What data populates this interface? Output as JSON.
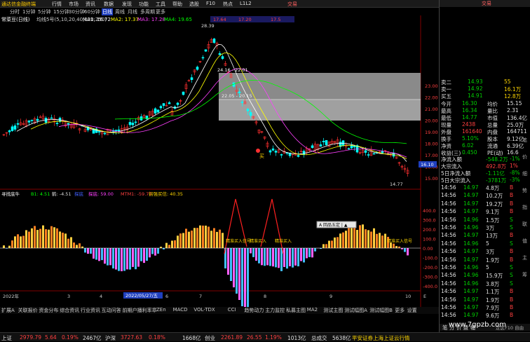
{
  "menubar": {
    "logo_text": "通达信金融终端",
    "items": [
      "行情",
      "市场",
      "资讯",
      "数据",
      "发现",
      "功能",
      "工具",
      "帮助",
      "选股",
      "F10",
      "热点",
      "L1L2",
      "交易"
    ]
  },
  "periods": [
    "分时",
    "1分钟",
    "5分钟",
    "15分钟",
    "30分钟",
    "60分钟",
    "日线",
    "周线",
    "月线",
    "多周期",
    "更多"
  ],
  "active_period": "日线",
  "main_chart": {
    "title": "常菜豆(日线)",
    "ma_label": "均线5号(5,10,20,40,120,250)",
    "ma1": "MA1: 16.72",
    "ma2": "MA2: 17.37",
    "ma3": "MA3: 17.28",
    "ma4": "MA4: 19.65",
    "extra1": "17.64",
    "extra2": "17.20",
    "extra3": "17.5",
    "high_label": "28.39",
    "low_label": "14.77",
    "box_label1": "24.16 - 22.01",
    "box_label2": "22.05 - 20.15",
    "buy_label": "买",
    "price_ticks": [
      "23.00",
      "22.00",
      "21.00",
      "20.00",
      "19.00",
      "18.00",
      "17.00",
      "16.00",
      "15.00"
    ],
    "current_price": "16.10"
  },
  "indicator": {
    "name": "寻找底牛",
    "v1": "B1: 4.51",
    "v2": "鹤: -4.51",
    "v3": "探底",
    "v4": "探底: 59.00",
    "v5": "MTM1: -59.77",
    "v6": "拐强买信: 40.35",
    "ticks": [
      "400.0",
      "300.0",
      "200.0",
      "100.0",
      "0.00",
      "-100.0",
      "-200.0",
      "-300.0",
      "-400.0"
    ],
    "tooltip": "A 回品五定 | ▲",
    "signal_labels": [
      "精准买入信号",
      "精准买入",
      "精准买入",
      "精准买入信号"
    ]
  },
  "date_axis": {
    "labels": [
      "2022年",
      "3",
      "4",
      "5",
      "6",
      "7",
      "8",
      "9",
      "10",
      "E"
    ],
    "highlight": "2022/05/27/五"
  },
  "bottom_tabs": [
    "扩展A",
    "关联报价",
    "资金分布",
    "综合资讯",
    "行业资讯",
    "互动问答",
    "前期户播利率章",
    "ZEn",
    "MACD",
    "VOL-TDX",
    "CCI",
    "趋势动力",
    "主力监控",
    "私募主图",
    "MA2",
    "测试主图",
    "测试幅图A",
    "测试幅图B",
    "更多",
    "设置"
  ],
  "right_panel": {
    "ask": [
      {
        "label": "卖二",
        "price": "14.93",
        "vol": "55"
      },
      {
        "label": "卖一",
        "price": "14.92",
        "vol": "16.1万"
      },
      {
        "label": "买五",
        "price": "14.91",
        "vol": "12.8万"
      }
    ],
    "stats": [
      {
        "l1": "今开",
        "v1": "16.30",
        "l2": "均价",
        "v2": "15.15"
      },
      {
        "l1": "最高",
        "v1": "16.34",
        "l2": "量比",
        "v2": "2.31"
      },
      {
        "l1": "最低",
        "v1": "14.77",
        "l2": "市值",
        "v2": "136.4亿"
      },
      {
        "l1": "现量",
        "v1": "2438",
        "l2": "总量",
        "v2": "25.0万"
      },
      {
        "l1": "外盘",
        "v1": "161640",
        "l2": "内盘",
        "v2": "164711"
      },
      {
        "l1": "换手",
        "v1": "5.10%",
        "l2": "股本",
        "v2": "9.12亿"
      },
      {
        "l1": "净资",
        "v1": "6.02",
        "l2": "流通",
        "v2": "6.39亿"
      },
      {
        "l1": "收益(三)",
        "v1": "0.450",
        "l2": "PE(动)",
        "v2": "16.6"
      }
    ],
    "flows": [
      {
        "label": "净流入额",
        "value": "-548.2万",
        "pct": "-1%"
      },
      {
        "label": "大宗流入",
        "value": "492.8万",
        "pct": "1%"
      },
      {
        "label": "5日净流入额",
        "value": "-1.11亿",
        "pct": "-8%"
      },
      {
        "label": "5日大宗流入",
        "value": "-3781万",
        "pct": "-3%"
      }
    ],
    "ticks": [
      {
        "t": "14:56",
        "p": "14.97",
        "v": "4.8万",
        "d": "B"
      },
      {
        "t": "14:56",
        "p": "14.97",
        "v": "10.2万",
        "d": "B"
      },
      {
        "t": "14:56",
        "p": "14.97",
        "v": "19.2万",
        "d": "B"
      },
      {
        "t": "14:56",
        "p": "14.97",
        "v": "9.1万",
        "d": "B"
      },
      {
        "t": "14:56",
        "p": "14.96",
        "v": "1.5万",
        "d": "S"
      },
      {
        "t": "14:56",
        "p": "14.96",
        "v": "3万",
        "d": "S"
      },
      {
        "t": "14:56",
        "p": "14.97",
        "v": "13万",
        "d": "B"
      },
      {
        "t": "14:56",
        "p": "14.96",
        "v": "5",
        "d": "S"
      },
      {
        "t": "14:56",
        "p": "14.97",
        "v": "3万",
        "d": "B"
      },
      {
        "t": "14:56",
        "p": "14.97",
        "v": "1.9万",
        "d": "B"
      },
      {
        "t": "14:56",
        "p": "14.96",
        "v": "5",
        "d": "S"
      },
      {
        "t": "14:56",
        "p": "14.96",
        "v": "15.9万",
        "d": "S"
      },
      {
        "t": "14:56",
        "p": "14.96",
        "v": "3.8万",
        "d": "S"
      },
      {
        "t": "14:56",
        "p": "14.97",
        "v": "1.1万",
        "d": "B"
      },
      {
        "t": "14:56",
        "p": "14.97",
        "v": "1.9万",
        "d": "B"
      },
      {
        "t": "14:56",
        "p": "14.97",
        "v": "7.9万",
        "d": "B"
      },
      {
        "t": "14:56",
        "p": "14.97",
        "v": "9.6万",
        "d": "B"
      }
    ],
    "side_tabs": [
      "笔",
      "价",
      "细",
      "势",
      "指",
      "联",
      "值",
      "主",
      "筹"
    ],
    "tab_bar": "笔  分  价  盘  幅"
  },
  "statusbar": {
    "items": [
      {
        "label": "上证",
        "value": "2979.79",
        "change": "5.64",
        "pct": "0.19%",
        "amount": "2467亿"
      },
      {
        "label": "沪深",
        "value": "3727.63",
        "change": "",
        "pct": "0.18%",
        "amount": "1668亿"
      },
      {
        "label": "创业",
        "value": "2261.89",
        "change": "26.55",
        "pct": "1.19%",
        "amount": "1013亿"
      },
      {
        "label": "总成交",
        "value": "5638亿",
        "change": "",
        "pct": "",
        "amount": ""
      }
    ],
    "broker": "平安证券上海上证云行情",
    "watermark": "www.7gpzb.com",
    "footer_code": "定区F10 自由"
  }
}
